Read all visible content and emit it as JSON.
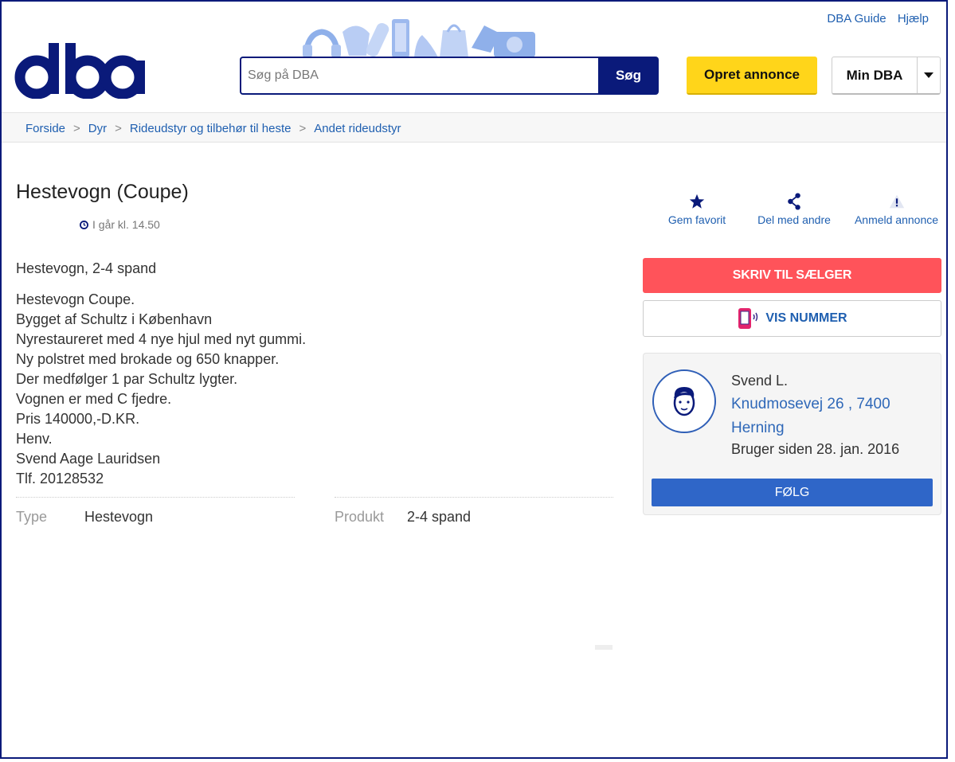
{
  "header": {
    "links": [
      "DBA Guide",
      "Hjælp"
    ],
    "search": {
      "placeholder": "Søg på DBA",
      "button": "Søg"
    },
    "opret": "Opret annonce",
    "mindba": "Min DBA"
  },
  "breadcrumb": [
    "Forside",
    "Dyr",
    "Rideudstyr og tilbehør til heste",
    "Andet rideudstyr"
  ],
  "ad": {
    "title": "Hestevogn (Coupe)",
    "time": "I går kl. 14.50",
    "subtitle": "Hestevogn, 2-4 spand",
    "description": [
      "Hestevogn Coupe.",
      "Bygget af Schultz i København",
      "Nyrestaureret med 4 nye hjul med nyt gummi.",
      "Ny polstret med brokade og 650 knapper.",
      "Der medfølger 1 par Schultz lygter.",
      "Vognen er med C fjedre.",
      "Pris 140000,-D.KR.",
      "Henv.",
      "Svend Aage Lauridsen",
      "Tlf. 20128532"
    ],
    "props": [
      {
        "key": "Type",
        "value": "Hestevogn"
      },
      {
        "key": "Produkt",
        "value": "2-4 spand"
      }
    ]
  },
  "actions": {
    "fav": "Gem favorit",
    "share": "Del med andre",
    "report": "Anmeld annonce"
  },
  "contact": {
    "write": "SKRIV TIL SÆLGER",
    "show_number": "VIS NUMMER"
  },
  "seller": {
    "name": "Svend L.",
    "address_line1": "Knudmosevej 26 , 7400",
    "address_line2": "Herning",
    "since": "Bruger siden 28. jan. 2016",
    "follow": "FØLG"
  },
  "colors": {
    "brand": "#0a1a7a",
    "yellow": "#ffd51a",
    "red": "#ff535a",
    "link": "#1f5fb0",
    "follow": "#2f66c8"
  },
  "icons": [
    "dba-logo",
    "search-icon",
    "caret-down-icon",
    "clock-icon",
    "star-icon",
    "share-icon",
    "warning-icon",
    "phone-icon",
    "user-avatar-icon"
  ]
}
